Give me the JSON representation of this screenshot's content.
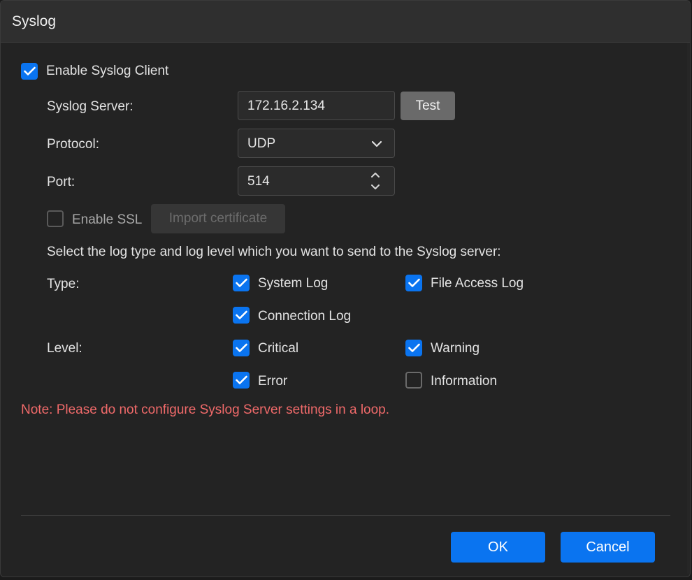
{
  "dialog": {
    "title": "Syslog"
  },
  "enable_client": {
    "label": "Enable Syslog Client",
    "checked": true
  },
  "server": {
    "label": "Syslog Server:",
    "value": "172.16.2.134",
    "test_label": "Test"
  },
  "protocol": {
    "label": "Protocol:",
    "value": "UDP"
  },
  "port": {
    "label": "Port:",
    "value": "514"
  },
  "ssl": {
    "label": "Enable SSL",
    "checked": false,
    "import_label": "Import certificate"
  },
  "instructions": "Select the log type and log level which you want to send to the Syslog server:",
  "type": {
    "label": "Type:",
    "options": [
      {
        "label": "System Log",
        "checked": true
      },
      {
        "label": "File Access Log",
        "checked": true
      },
      {
        "label": "Connection Log",
        "checked": true
      }
    ]
  },
  "level": {
    "label": "Level:",
    "options": [
      {
        "label": "Critical",
        "checked": true
      },
      {
        "label": "Warning",
        "checked": true
      },
      {
        "label": "Error",
        "checked": true
      },
      {
        "label": "Information",
        "checked": false
      }
    ]
  },
  "note": "Note: Please do not configure Syslog Server settings in a loop.",
  "footer": {
    "ok_label": "OK",
    "cancel_label": "Cancel"
  },
  "colors": {
    "accent": "#0a74f0",
    "warning_text": "#f06a6a"
  }
}
